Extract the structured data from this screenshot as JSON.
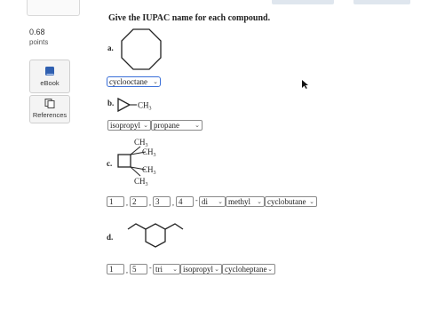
{
  "score": {
    "value": "0.68",
    "unit": "points"
  },
  "sidebar": {
    "ebook_label": "eBook",
    "references_label": "References"
  },
  "question": {
    "prompt": "Give the IUPAC name for each compound.",
    "parts": {
      "a": {
        "label": "a.",
        "answer": "cyclooctane"
      },
      "b": {
        "label": "b.",
        "substituent": "CH",
        "substituent_sub": "3",
        "answer_prefix": "isopropyl",
        "answer_parent": "propane"
      },
      "c": {
        "label": "c.",
        "methyl_groups": [
          "CH",
          "CH",
          "CH",
          "CH"
        ],
        "methyl_sub": "3",
        "locants": [
          "1",
          "2",
          "3",
          "4"
        ],
        "multiplier": "di",
        "substituent": "methyl",
        "parent": "cyclobutane"
      },
      "d": {
        "label": "d.",
        "locants": [
          "1",
          "5"
        ],
        "multiplier": "tri",
        "substituent": "isopropyl",
        "parent": "cycloheptane"
      }
    }
  }
}
